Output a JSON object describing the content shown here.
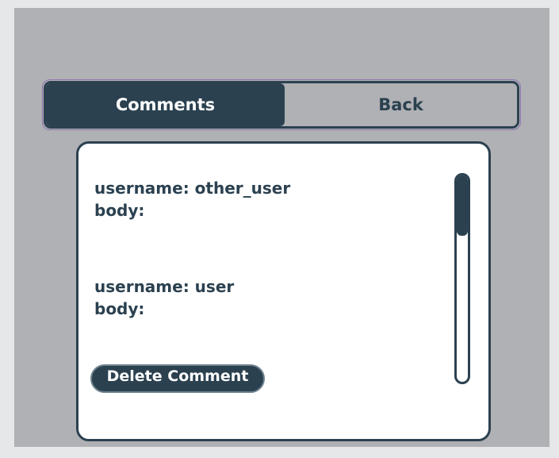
{
  "tabs": {
    "comments_label": "Comments",
    "back_label": "Back",
    "active": "Comments"
  },
  "comments": [
    {
      "username_line": "username: other_user",
      "body_line": "body:"
    },
    {
      "username_line": "username: user",
      "body_line": "body:"
    }
  ],
  "actions": {
    "delete_label": "Delete Comment"
  },
  "scroll": {
    "position_fraction": 0.0
  },
  "colors": {
    "accent": "#2b4150",
    "frame": "#b0b1b4",
    "page": "#e6e7e9",
    "panel": "#ffffff"
  }
}
